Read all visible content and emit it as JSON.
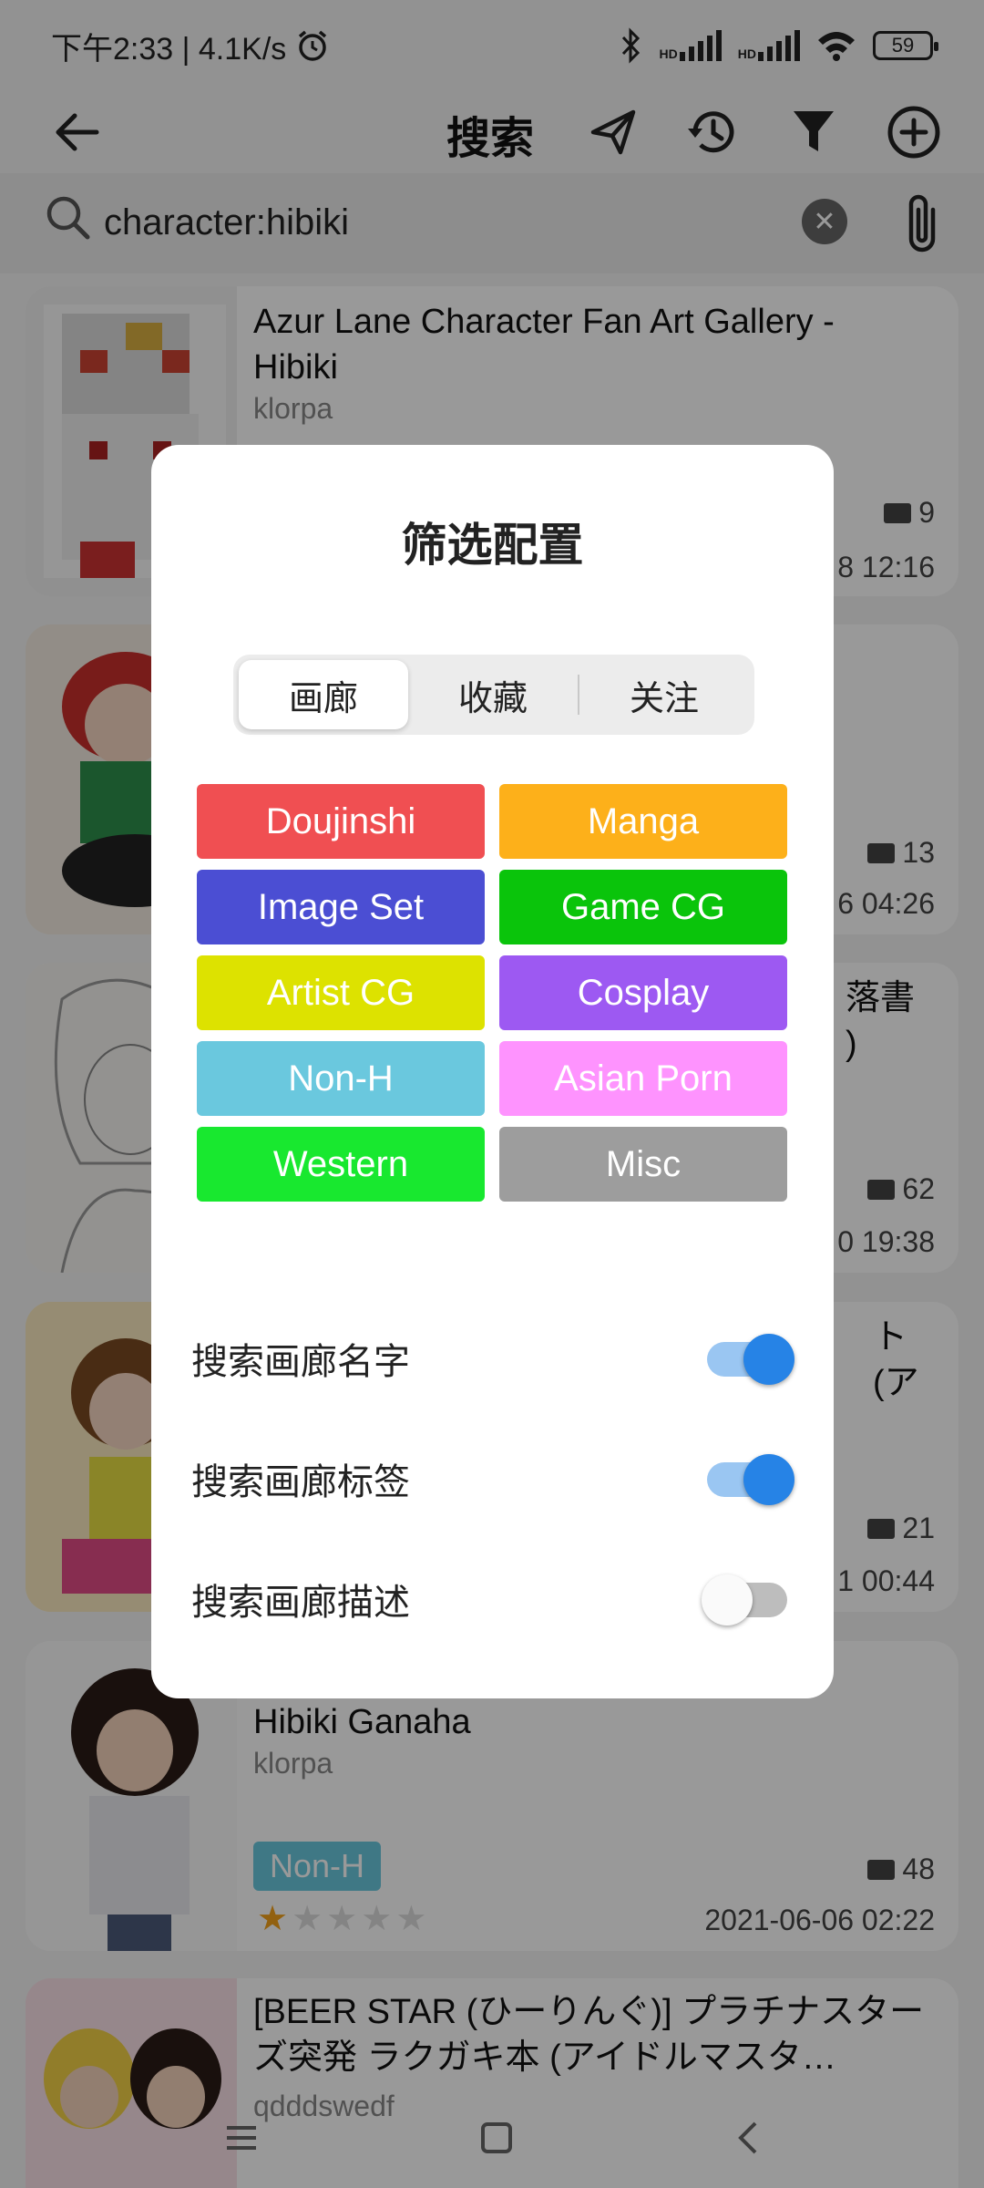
{
  "status_bar": {
    "time_speed": "下午2:33 | 4.1K/s",
    "battery": "59",
    "signal_label_1": "HD",
    "signal_label_2": "HD"
  },
  "app_bar": {
    "title": "搜索",
    "icons": [
      "back-arrow-icon",
      "send-icon",
      "history-icon",
      "filter-icon",
      "add-circle-icon"
    ]
  },
  "search": {
    "value": "character:hibiki",
    "placeholder": ""
  },
  "list": [
    {
      "title": "Azur Lane Character Fan Art Gallery - Hibiki",
      "uploader": "klorpa",
      "pages": "9",
      "date": "8 12:16"
    },
    {
      "title": "",
      "uploader": "",
      "pages": "13",
      "date": "6 04:26"
    },
    {
      "title": "落書\n)",
      "uploader": "",
      "pages": "62",
      "date": "0 19:38"
    },
    {
      "title": "ト (ア",
      "uploader": "",
      "pages": "21",
      "date": "1 00:44"
    },
    {
      "title": "ry -\nHibiki Ganaha",
      "uploader": "klorpa",
      "category": "Non-H",
      "rating": 0.5,
      "pages": "48",
      "date": "2021-06-06 02:22"
    },
    {
      "title": "[BEER STAR (ひーりんぐ)] プラチナスターズ突発 ラクガキ本 (アイドルマスタ…",
      "uploader": "qdddswedf"
    }
  ],
  "dialog": {
    "title": "筛选配置",
    "tabs": [
      "画廊",
      "收藏",
      "关注"
    ],
    "active_tab": 0,
    "categories": [
      {
        "label": "Doujinshi",
        "color": "#f04f52"
      },
      {
        "label": "Manga",
        "color": "#fdb01a"
      },
      {
        "label": "Image Set",
        "color": "#4b4ed3"
      },
      {
        "label": "Game CG",
        "color": "#0ac40b"
      },
      {
        "label": "Artist CG",
        "color": "#dde200"
      },
      {
        "label": "Cosplay",
        "color": "#9d59f2"
      },
      {
        "label": "Non-H",
        "color": "#6ac8de"
      },
      {
        "label": "Asian Porn",
        "color": "#fe93fe"
      },
      {
        "label": "Western",
        "color": "#18e82f"
      },
      {
        "label": "Misc",
        "color": "#9d9d9d"
      }
    ],
    "switches": [
      {
        "label": "搜索画廊名字",
        "on": true
      },
      {
        "label": "搜索画廊标签",
        "on": true
      },
      {
        "label": "搜索画廊描述",
        "on": false
      }
    ]
  },
  "nav": {
    "icons": [
      "menu-icon",
      "home-icon",
      "back-icon"
    ]
  }
}
